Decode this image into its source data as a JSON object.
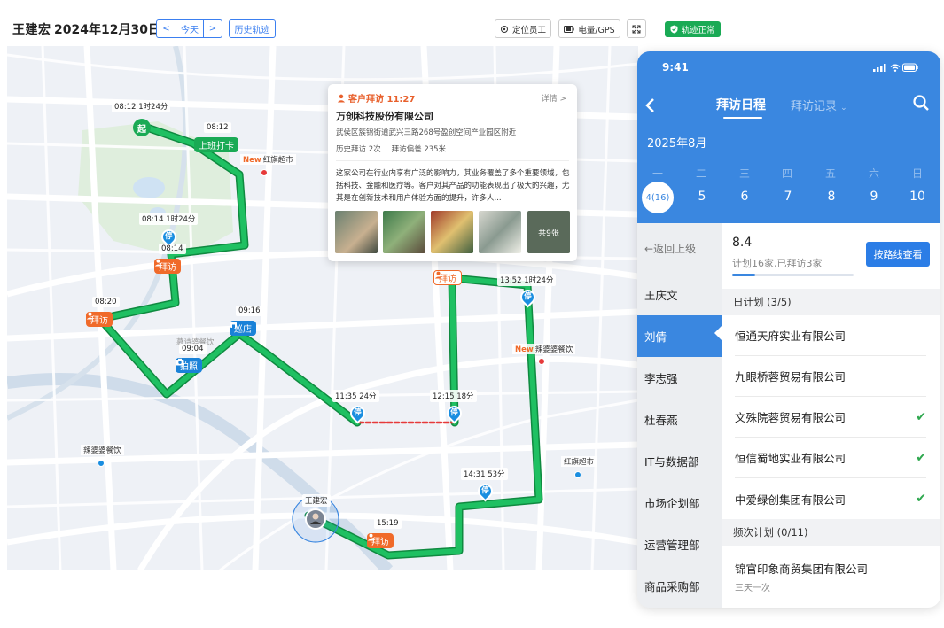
{
  "header": {
    "employee": "王建宏",
    "date": "2024年12月30日",
    "prev": "<",
    "today": "今天",
    "next": ">",
    "history": "历史轨迹",
    "locate": "定位员工",
    "power": "电量/GPS",
    "status": "轨迹正常"
  },
  "popup": {
    "type_time": "客户拜访 11:27",
    "detail": "详情 >",
    "company": "万创科技股份有限公司",
    "address": "武侯区簇锦街道武兴三路268号盈创空间产业园区附近",
    "visit_count": "历史拜访 2次",
    "deviation": "拜访偏差 235米",
    "description": "这家公司在行业内享有广泛的影响力，其业务覆盖了多个重要领域，包括科技、金融和医疗等。客户对其产品的功能表现出了极大的兴趣，尤其是在创新技术和用户体验方面的提升，许多人...",
    "more_photos": "共9张"
  },
  "map": {
    "labels": {
      "start_time": "08:12  1时24分",
      "clock_in_time": "08:12",
      "stop1": "08:14  1时24分",
      "visit1_time": "08:14",
      "visit2_time": "08:20",
      "patrol_time": "09:16",
      "photo_time": "09:04",
      "stop_1135": "11:35  24分",
      "stop_1215": "12:15  18分",
      "stop_1352": "13:52  1时24分",
      "stop_1431": "14:31  53分",
      "visit_end_time": "15:19",
      "employee": "王建宏",
      "photo_faded": "慕诗婆餐饮"
    },
    "tags": {
      "start": "起",
      "clock_in": "上班打卡",
      "visit": "拜访",
      "patrol": "巡店",
      "photo": "拍照"
    },
    "stop_glyph": "停",
    "new_badge": "New",
    "pois": {
      "hongqi1": "红旗超市",
      "lapo1": "辣婆婆餐饮",
      "lapo2": "辣婆婆餐饮",
      "hongqi2": "红旗超市"
    }
  },
  "phone": {
    "time": "9:41",
    "tab_active": "拜访日程",
    "tab_other": "拜访记录",
    "month": "2025年8月",
    "weekdays": [
      "一",
      "二",
      "三",
      "四",
      "五",
      "六",
      "日"
    ],
    "days": [
      "4(16)",
      "5",
      "6",
      "7",
      "8",
      "9",
      "10"
    ],
    "sidebar_back": "返回上级",
    "sidebar": [
      "王庆文",
      "刘倩",
      "李志强",
      "杜春燕",
      "IT与数据部",
      "市场企划部",
      "运营管理部",
      "商品采购部"
    ],
    "score": "8.4",
    "plan_sub": "计划16家,已拜访3家",
    "progress": 0.19,
    "route_btn": "按路线查看",
    "daily_plan": "日计划 (3/5)",
    "companies": [
      "恒通天府实业有限公司",
      "九眼桥蓉贸易有限公司",
      "文殊院蓉贸易有限公司",
      "恒信蜀地实业有限公司",
      "中爱绿创集团有限公司"
    ],
    "freq_plan": "频次计划 (0/11)",
    "freq_company": "锦官印象商贸集团有限公司",
    "freq_sub": "三天一次"
  },
  "colors": {
    "route": "#1aaa55",
    "accent": "#3a87e0",
    "visit": "#f06a2a",
    "stop": "#1a8ee0"
  }
}
